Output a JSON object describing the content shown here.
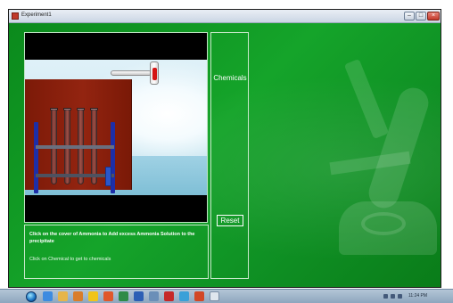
{
  "window": {
    "title": "Experiment1",
    "minimize_icon": "minimize-icon",
    "maximize_icon": "maximize-icon",
    "close_icon": "close-icon"
  },
  "simulation": {
    "scene_objects": [
      "test-tube-rack",
      "test-tubes",
      "dropper-bottle",
      "small-bottle"
    ]
  },
  "controls": {
    "chemicals_label": "Chemicals",
    "reset_label": "Reset"
  },
  "instructions": {
    "main": "Click on the cover of Ammonia to Add excess Ammonia Solution to the precipitate",
    "hint": "Click on Chemical to get to chemicals"
  },
  "taskbar": {
    "clock": "11:24 PM",
    "pinned_icons": [
      "ie-icon",
      "folder-icon",
      "media-player-icon",
      "chrome-icon",
      "firefox-icon",
      "excel-icon",
      "word-icon",
      "paint-icon",
      "pdf-icon",
      "globe-icon",
      "powerpoint-icon",
      "document-icon"
    ]
  },
  "colors": {
    "background_green": "#13a029",
    "backboard": "#8c220e",
    "rack_blue": "#1d2ea8",
    "dropper_red": "#d41414"
  }
}
